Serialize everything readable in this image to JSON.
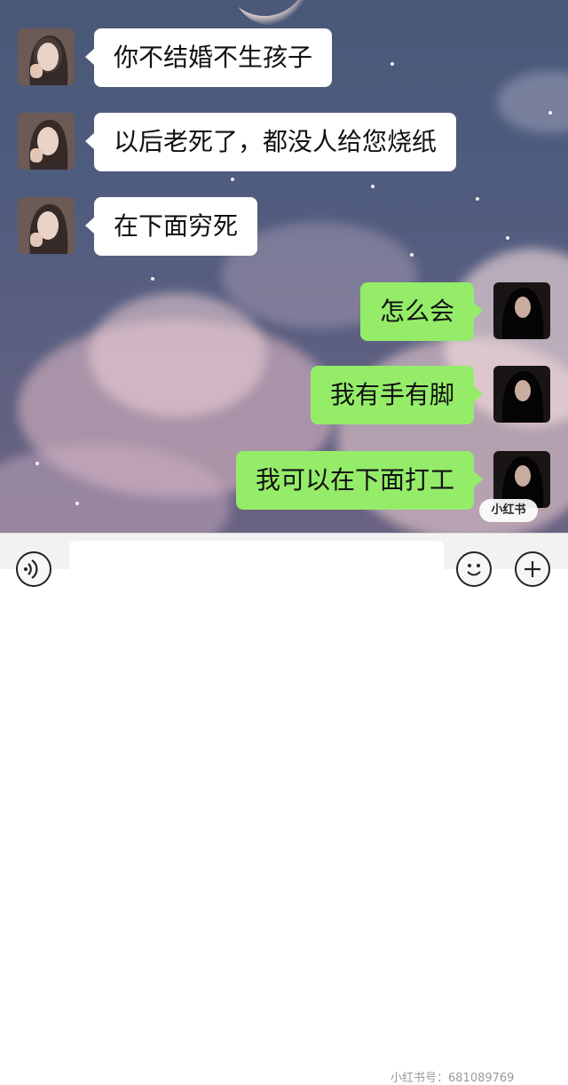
{
  "messages": [
    {
      "side": "left",
      "text": "你不结婚不生孩子"
    },
    {
      "side": "left",
      "text": "以后老死了，都没人给您烧纸"
    },
    {
      "side": "left",
      "text": "在下面穷死"
    },
    {
      "side": "right",
      "text": "怎么会"
    },
    {
      "side": "right",
      "text": "我有手有脚"
    },
    {
      "side": "right",
      "text": "我可以在下面打工"
    }
  ],
  "watermark": {
    "logo_text": "小红书",
    "id_text": "小红书号：681089769"
  },
  "colors": {
    "sent_bubble": "#95ec69",
    "received_bubble": "#ffffff",
    "input_bar": "#f2f2f2"
  },
  "icons": {
    "voice": "voice-icon",
    "emoji": "emoji-icon",
    "plus": "plus-icon"
  }
}
